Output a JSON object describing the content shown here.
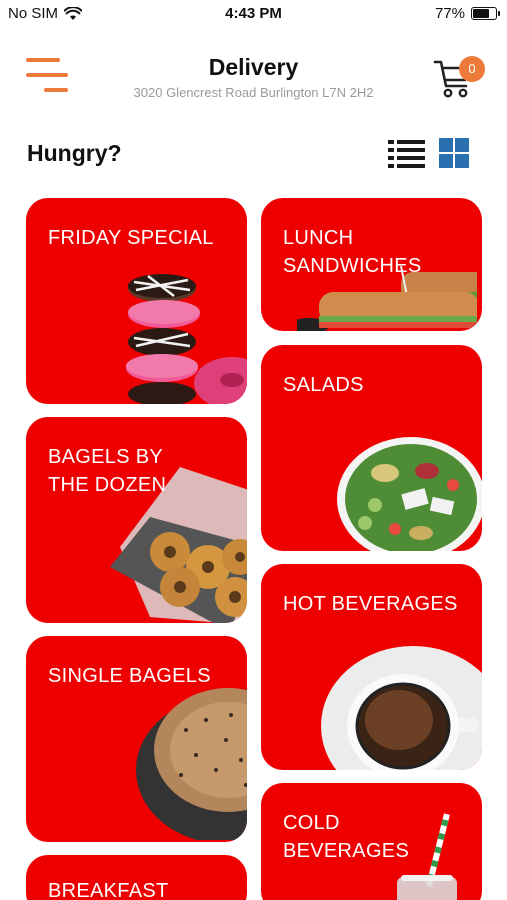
{
  "status_bar": {
    "carrier": "No SIM",
    "time": "4:43 PM",
    "battery_percent": "77%",
    "battery_level": 0.77
  },
  "header": {
    "title": "Delivery",
    "address": "3020 Glencrest Road   Burlington L7N 2H2",
    "cart_count": "0"
  },
  "section_title": "Hungry?",
  "colors": {
    "accent": "#ec7b3a",
    "card_red": "#ee0000",
    "grid_icon_blue": "#2a6fb0"
  },
  "categories": [
    {
      "label": "FRIDAY SPECIAL",
      "image": "donut-stack-image"
    },
    {
      "label": "LUNCH SANDWICHES",
      "image": "sub-sandwich-image"
    },
    {
      "label": "SALADS",
      "image": "salad-bowl-image"
    },
    {
      "label": "BAGELS BY THE DOZEN",
      "image": "bagel-tray-image"
    },
    {
      "label": "HOT BEVERAGES",
      "image": "coffee-cup-image"
    },
    {
      "label": "SINGLE BAGELS",
      "image": "everything-bagel-image"
    },
    {
      "label": "COLD BEVERAGES",
      "image": "iced-drink-image"
    },
    {
      "label": "BREAKFAST",
      "image": ""
    }
  ]
}
